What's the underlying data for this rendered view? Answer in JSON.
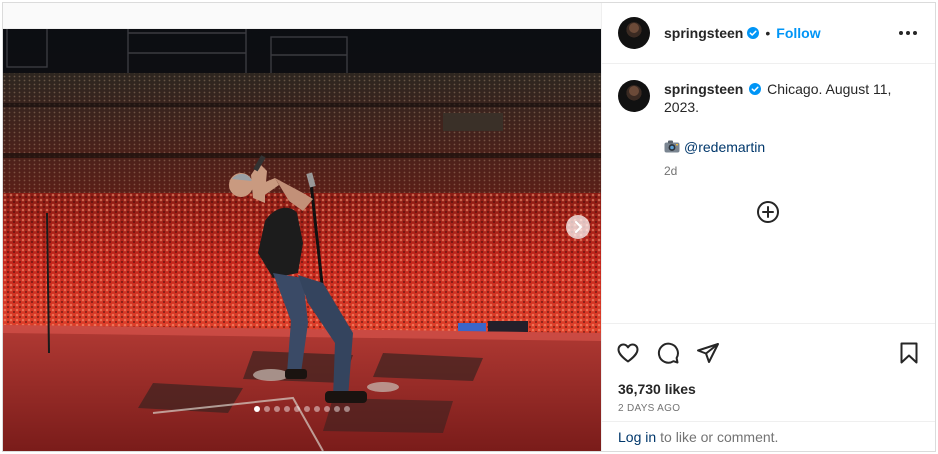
{
  "post": {
    "username": "springsteen",
    "verified": true,
    "bullet": "•",
    "follow_label": "Follow",
    "caption": "Chicago. August 11, 2023.",
    "credit_handle": "@redemartin",
    "relative_time": "2d",
    "likes": "36,730 likes",
    "date_label": "2 DAYS AGO",
    "login_link": "Log in",
    "login_suffix": "to like or comment."
  },
  "media": {
    "carousel_count": 10,
    "active_index": 0
  },
  "colors": {
    "accent": "#0095f6",
    "link": "#00376b",
    "stage_red": "#d41e1e"
  },
  "icons": [
    "more-options-icon",
    "verified-badge-icon",
    "add-comment-icon",
    "like-heart-icon",
    "comment-icon",
    "share-icon",
    "save-bookmark-icon",
    "chevron-right-icon",
    "camera-emoji-icon"
  ]
}
